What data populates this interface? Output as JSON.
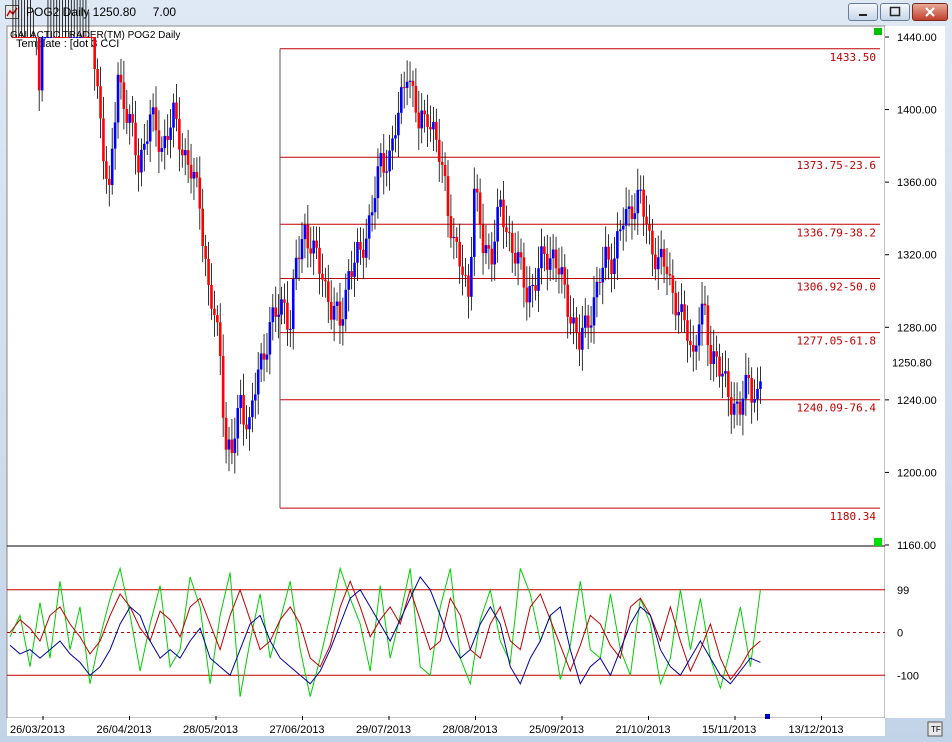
{
  "window": {
    "title": "POG2 Daily 1250.80     7.00",
    "colors": {
      "frame": "#c9d7e8",
      "up_bar": "#0000ff",
      "down_bar": "#ff0000",
      "fib_line": "#c00000"
    }
  },
  "chart_data": [
    {
      "type": "candlestick",
      "header_text": "GALACTIC TRADER(TM)     POG2 Daily",
      "template_text": "Template : [dot 3 CCI",
      "current_price_label": "1250.80",
      "ylim": [
        1160,
        1440
      ],
      "y_ticks": [
        "1160.00",
        "1200.00",
        "1240.00",
        "1280.00",
        "1320.00",
        "1360.00",
        "1400.00",
        "1440.00"
      ],
      "x_ticks": [
        "26/03/2013",
        "26/04/2013",
        "28/05/2013",
        "27/06/2013",
        "29/07/2013",
        "28/08/2013",
        "25/09/2013",
        "21/10/2013",
        "15/11/2013",
        "13/12/2013"
      ],
      "fib_levels": [
        {
          "value": 1433.5,
          "label": "1433.50"
        },
        {
          "value": 1373.75,
          "label": "1373.75-23.6"
        },
        {
          "value": 1336.79,
          "label": "1336.79-38.2"
        },
        {
          "value": 1306.92,
          "label": "1306.92-50.0"
        },
        {
          "value": 1277.05,
          "label": "1277.05-61.8"
        },
        {
          "value": 1240.09,
          "label": "1240.09-76.4"
        },
        {
          "value": 1180.34,
          "label": "1180.34"
        }
      ],
      "grid": false,
      "anchors": [
        [
          0,
          1600
        ],
        [
          10,
          1420
        ],
        [
          14,
          1560
        ],
        [
          20,
          1470
        ],
        [
          24,
          1505
        ],
        [
          28,
          1440
        ],
        [
          34,
          1350
        ],
        [
          37,
          1420
        ],
        [
          44,
          1370
        ],
        [
          48,
          1395
        ],
        [
          52,
          1380
        ],
        [
          56,
          1395
        ],
        [
          60,
          1375
        ],
        [
          65,
          1350
        ],
        [
          68,
          1300
        ],
        [
          70,
          1285
        ],
        [
          72,
          1265
        ],
        [
          74,
          1215
        ],
        [
          76,
          1210
        ],
        [
          79,
          1240
        ],
        [
          82,
          1225
        ],
        [
          85,
          1255
        ],
        [
          89,
          1280
        ],
        [
          94,
          1295
        ],
        [
          96,
          1280
        ],
        [
          98,
          1315
        ],
        [
          101,
          1335
        ],
        [
          104,
          1320
        ],
        [
          107,
          1310
        ],
        [
          110,
          1290
        ],
        [
          113,
          1282
        ],
        [
          116,
          1310
        ],
        [
          120,
          1320
        ],
        [
          124,
          1345
        ],
        [
          127,
          1370
        ],
        [
          130,
          1375
        ],
        [
          133,
          1395
        ],
        [
          136,
          1425
        ],
        [
          140,
          1390
        ],
        [
          143,
          1400
        ],
        [
          146,
          1380
        ],
        [
          149,
          1360
        ],
        [
          152,
          1325
        ],
        [
          155,
          1310
        ],
        [
          157,
          1300
        ],
        [
          159,
          1355
        ],
        [
          162,
          1325
        ],
        [
          165,
          1322
        ],
        [
          168,
          1345
        ],
        [
          171,
          1330
        ],
        [
          174,
          1315
        ],
        [
          177,
          1300
        ],
        [
          180,
          1305
        ],
        [
          183,
          1320
        ],
        [
          186,
          1320
        ],
        [
          189,
          1305
        ],
        [
          192,
          1288
        ],
        [
          195,
          1270
        ],
        [
          198,
          1285
        ],
        [
          201,
          1300
        ],
        [
          204,
          1318
        ],
        [
          207,
          1320
        ],
        [
          210,
          1338
        ],
        [
          213,
          1348
        ],
        [
          216,
          1350
        ],
        [
          219,
          1330
        ],
        [
          222,
          1315
        ],
        [
          225,
          1313
        ],
        [
          227,
          1300
        ],
        [
          230,
          1283
        ],
        [
          232,
          1278
        ],
        [
          234,
          1265
        ],
        [
          236,
          1285
        ],
        [
          238,
          1285
        ],
        [
          240,
          1265
        ],
        [
          242,
          1265
        ],
        [
          244,
          1250
        ],
        [
          247,
          1240
        ],
        [
          250,
          1235
        ],
        [
          253,
          1250
        ],
        [
          256,
          1242
        ],
        [
          257,
          1250
        ]
      ],
      "series_colors": {
        "up": "#0000ff",
        "down": "#ff0000"
      }
    },
    {
      "type": "line",
      "y_ticks": [
        "99",
        "0",
        "-100"
      ],
      "ylim": [
        -200,
        200
      ],
      "reference_lines": [
        100,
        0,
        -100
      ],
      "series": [
        {
          "color": "#00d000",
          "values": [
            -10,
            40,
            -80,
            70,
            -60,
            120,
            -40,
            60,
            -120,
            -10,
            80,
            150,
            40,
            -90,
            20,
            110,
            -80,
            -40,
            130,
            60,
            -120,
            40,
            140,
            -150,
            -20,
            90,
            -60,
            30,
            120,
            -40,
            -150,
            -60,
            40,
            150,
            80,
            20,
            -90,
            110,
            -60,
            40,
            150,
            -80,
            -100,
            60,
            150,
            -60,
            -120,
            30,
            100,
            -20,
            -70,
            150,
            90,
            -20,
            40,
            -110,
            -30,
            120,
            -40,
            -60,
            90,
            -40,
            -100,
            80,
            20,
            -120,
            -60,
            100,
            -40,
            80,
            -60,
            -130,
            -40,
            60,
            -80,
            100
          ]
        },
        {
          "color": "#c00000",
          "values": [
            0,
            30,
            10,
            -20,
            40,
            60,
            20,
            -10,
            -50,
            -20,
            40,
            90,
            60,
            10,
            -20,
            50,
            30,
            -10,
            60,
            80,
            20,
            -40,
            40,
            100,
            30,
            -40,
            -20,
            30,
            60,
            20,
            -60,
            -80,
            -30,
            60,
            120,
            60,
            -10,
            30,
            60,
            20,
            100,
            30,
            -40,
            -20,
            80,
            40,
            -40,
            -60,
            20,
            60,
            -20,
            -40,
            60,
            90,
            30,
            -30,
            -90,
            -30,
            40,
            20,
            -30,
            -60,
            60,
            80,
            40,
            -20,
            60,
            -20,
            -90,
            -40,
            20,
            -60,
            -110,
            -80,
            -40,
            -20
          ]
        },
        {
          "color": "#0000a0",
          "values": [
            -30,
            -50,
            -40,
            -60,
            -40,
            -20,
            -50,
            -70,
            -100,
            -80,
            -40,
            20,
            60,
            40,
            -20,
            -60,
            -40,
            -60,
            -20,
            10,
            -60,
            -80,
            -100,
            -40,
            20,
            40,
            -20,
            -60,
            -80,
            -100,
            -120,
            -90,
            -40,
            20,
            80,
            100,
            60,
            20,
            -20,
            30,
            80,
            130,
            100,
            40,
            -20,
            -60,
            -40,
            20,
            60,
            20,
            -80,
            -120,
            -60,
            -20,
            40,
            60,
            -40,
            -120,
            -80,
            -60,
            -100,
            -40,
            20,
            60,
            40,
            -40,
            -80,
            -100,
            -60,
            -20,
            -60,
            -100,
            -120,
            -90,
            -60,
            -70
          ]
        }
      ]
    }
  ]
}
